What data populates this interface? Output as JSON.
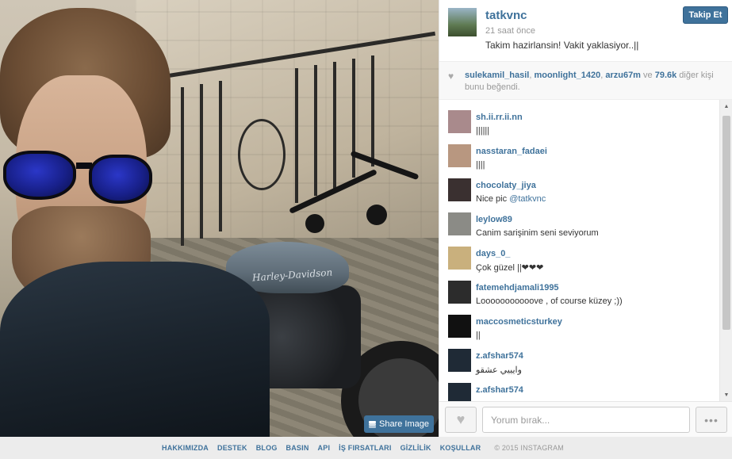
{
  "post": {
    "username": "tatkvnc",
    "time": "21 saat önce",
    "caption": "Takim hazirlansin! Vakit yaklasiyor..||",
    "follow_label": "Takip Et",
    "share_label": "Share Image",
    "tank_text": "Harley-Davidson"
  },
  "likes": {
    "user1": "sulekamil_hasil",
    "sep1": ", ",
    "user2": "moonlight_1420",
    "sep2": ", ",
    "user3": "arzu67m",
    "mid": " ve ",
    "count": "79.6k",
    "suffix": " diğer kişi bunu beğendi."
  },
  "comments": [
    {
      "user": "sh.ii.rr.ii.nn",
      "text": "||||||",
      "avatar_color": "#a98a8c"
    },
    {
      "user": "nasstaran_fadaei",
      "text": "||||",
      "avatar_color": "#b89780"
    },
    {
      "user": "chocolaty_jiya",
      "text": "Nice pic ",
      "mention": "@tatkvnc",
      "avatar_color": "#3a3030"
    },
    {
      "user": "leylow89",
      "text": "Canim sarişinim seni seviyorum",
      "avatar_color": "#8b8b86"
    },
    {
      "user": "days_0_",
      "text": "Çok güzel ||❤❤❤",
      "avatar_color": "#c9b07d"
    },
    {
      "user": "fatemehdjamali1995",
      "text": "Looooooooooove , of course küzey ;))",
      "avatar_color": "#2c2c2c"
    },
    {
      "user": "maccosmeticsturkey",
      "text": "||",
      "avatar_color": "#111111"
    },
    {
      "user": "z.afshar574",
      "text": "وايييي عشقو",
      "avatar_color": "#1f2a36"
    },
    {
      "user": "z.afshar574",
      "text": "",
      "avatar_color": "#1f2a36"
    }
  ],
  "input": {
    "placeholder": "Yorum bırak..."
  },
  "more_label": "•••",
  "footer": {
    "links": [
      "HAKKIMIZDA",
      "DESTEK",
      "BLOG",
      "BASIN",
      "API",
      "İŞ FIRSATLARI",
      "GİZLİLİK",
      "KOŞULLAR"
    ],
    "copyright": "© 2015 INSTAGRAM"
  },
  "colors": {
    "accent": "#3f729b",
    "muted": "#999999"
  }
}
